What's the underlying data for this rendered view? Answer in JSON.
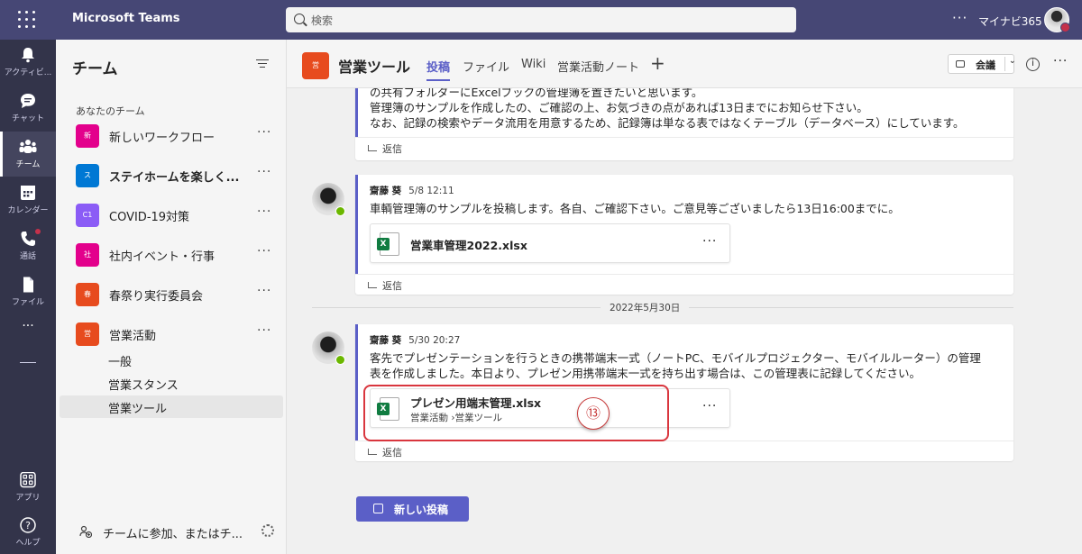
{
  "topbar": {
    "app_title": "Microsoft Teams",
    "search_placeholder": "検索",
    "more": "···",
    "org": "マイナビ365"
  },
  "rail": [
    {
      "label": "アクティビ..."
    },
    {
      "label": "チャット"
    },
    {
      "label": "チーム"
    },
    {
      "label": "カレンダー"
    },
    {
      "label": "通話"
    },
    {
      "label": "ファイル"
    },
    {
      "label": "···"
    },
    {
      "label": "アプリ"
    },
    {
      "label": "ヘルプ"
    }
  ],
  "teams_panel": {
    "title": "チーム",
    "section": "あなたのチーム",
    "teams": [
      {
        "name": "新しいワークフロー",
        "tile": "新",
        "color": "#e3008c"
      },
      {
        "name": "ステイホームを楽しく...",
        "tile": "ス",
        "color": "#0078d4"
      },
      {
        "name": "COVID-19対策",
        "tile": "C1",
        "color": "#8b5cf6"
      },
      {
        "name": "社内イベント・行事",
        "tile": "社",
        "color": "#e3008c"
      },
      {
        "name": "春祭り実行委員会",
        "tile": "春",
        "color": "#e74b1e"
      },
      {
        "name": "営業活動",
        "tile": "営",
        "color": "#e74b1e"
      }
    ],
    "more": "···",
    "channels": [
      "一般",
      "営業スタンス",
      "営業ツール"
    ],
    "join": "チームに参加、またはチ..."
  },
  "channel_header": {
    "tile": "営",
    "name": "営業ツール",
    "tabs": [
      "投稿",
      "ファイル",
      "Wiki",
      "営業活動ノート"
    ],
    "add": "+",
    "meet": "会議",
    "info": "i",
    "more": "···"
  },
  "posts": {
    "top": {
      "lines": [
        "の共有フォルダーにExcelブックの管理簿を置きたいと思います。",
        "管理簿のサンプルを作成したの、ご確認の上、お気づきの点があれば13日までにお知らせ下さい。",
        "なお、記録の検索やデータ流用を用意するため、記録簿は単なる表ではなくテーブル（データベース）にしています。"
      ],
      "reply": "返信"
    },
    "second": {
      "author": "齋藤 葵",
      "time": "5/8 12:11",
      "text": "車輌管理簿のサンプルを投稿します。各自、ご確認下さい。ご意見等ございましたら13日16:00までに。",
      "file_name": "営業車管理2022.xlsx",
      "file_more": "···",
      "reply": "返信"
    },
    "date_separator": "2022年5月30日",
    "third": {
      "author": "齋藤 葵",
      "time": "5/30 20:27",
      "lines": [
        "客先でプレゼンテーションを行うときの携帯端末一式（ノートPC、モバイルプロジェクター、モバイルルーター）の管理",
        "表を作成しました。本日より、プレゼン用携帯端末一式を持ち出す場合は、この管理表に記録してください。"
      ],
      "file_name": "プレゼン用端末管理.xlsx",
      "file_path": "営業活動 ›営業ツール",
      "file_more": "···",
      "reply": "返信"
    }
  },
  "annotation": {
    "step": "⑬",
    "color": "#d9363e"
  },
  "new_post_label": "新しい投稿",
  "colors": {
    "accent": "#5b5fc7",
    "topbar": "#464775",
    "rail": "#33344a",
    "excel": "#107c41"
  }
}
